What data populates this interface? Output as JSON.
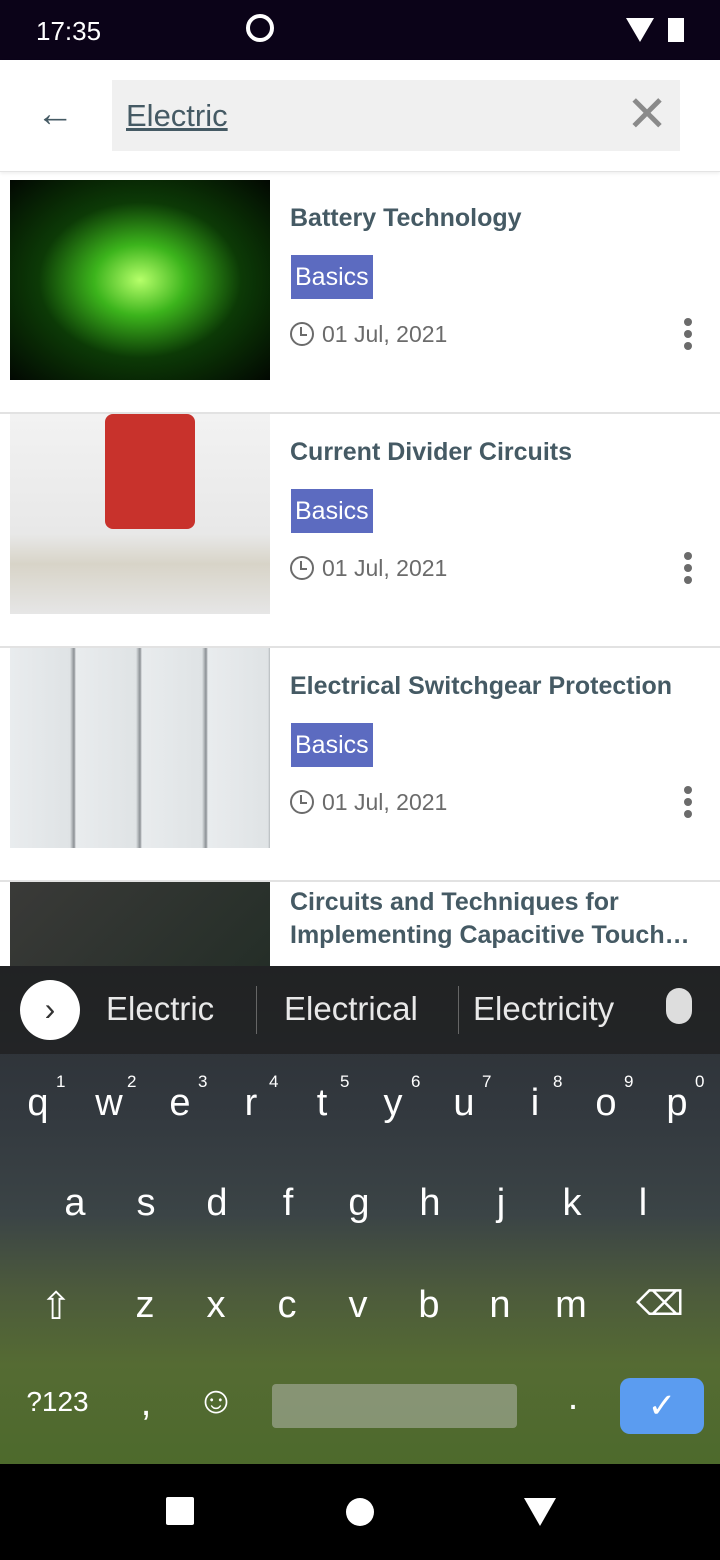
{
  "status": {
    "time": "17:35"
  },
  "search": {
    "value": "Electric"
  },
  "articles": [
    {
      "title": "Battery Technology",
      "tag": "Basics",
      "date": "01 Jul, 2021"
    },
    {
      "title": "Current Divider Circuits",
      "tag": "Basics",
      "date": "01 Jul, 2021"
    },
    {
      "title": "Electrical Switchgear Protection",
      "tag": "Basics",
      "date": "01 Jul, 2021"
    },
    {
      "title": "Circuits and Techniques for Implementing Capacitive Touch…"
    }
  ],
  "keyboard": {
    "suggestions": [
      "Electric",
      "Electrical",
      "Electricity"
    ],
    "row1": [
      "q",
      "w",
      "e",
      "r",
      "t",
      "y",
      "u",
      "i",
      "o",
      "p"
    ],
    "row1_hints": [
      "1",
      "2",
      "3",
      "4",
      "5",
      "6",
      "7",
      "8",
      "9",
      "0"
    ],
    "row2": [
      "a",
      "s",
      "d",
      "f",
      "g",
      "h",
      "j",
      "k",
      "l"
    ],
    "row3": [
      "z",
      "x",
      "c",
      "v",
      "b",
      "n",
      "m"
    ],
    "symbols": "?123",
    "comma": ",",
    "period": "."
  },
  "colors": {
    "tag": "#5c6bc0",
    "enter": "#5b9cf0"
  }
}
